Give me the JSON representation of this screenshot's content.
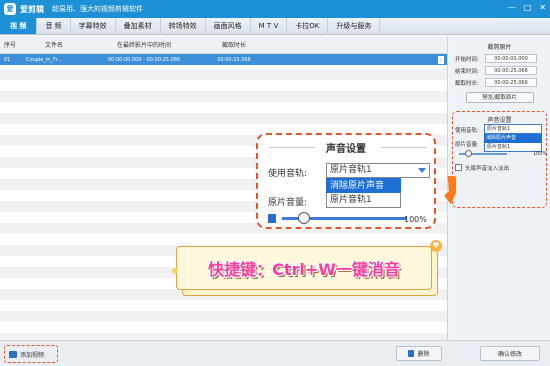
{
  "app": {
    "logo": "爱",
    "name": "爱剪辑",
    "slogan": "超易用、强大的视频剪辑软件",
    "window_buttons": [
      "—",
      "□",
      "✕"
    ]
  },
  "tabs": [
    "视 频",
    "音 频",
    "字幕特效",
    "叠加素材",
    "转场特效",
    "画面风格",
    "M T V",
    "卡拉OK",
    "升级与服务"
  ],
  "file_list": {
    "headers": [
      "序号",
      "文件名",
      "在最终影片中的时间",
      "截取时长"
    ],
    "rows": [
      {
        "index": "01",
        "filename": "Couple_In_Fr...",
        "time": "00:00:00.000 - 00:00:25.066",
        "duration": "00:00:25.066"
      }
    ],
    "row_menu": "⋮"
  },
  "bottom": {
    "add_video": "添加视频",
    "delete": "删除",
    "confirm": "确认修改"
  },
  "right_panel": {
    "cut_title": "裁剪原片",
    "start_label": "开始时间:",
    "start_value": "00:00:00.000",
    "end_label": "结束时间:",
    "end_value": "00:00:25.066",
    "duration_label": "截取时长:",
    "duration_value": "00:00:25.066",
    "preview_button": "预览/截取原片",
    "sound_title": "声音设置",
    "track_label": "使用音轨:",
    "track_selected": "原片音轨1",
    "options": [
      "消除原片声音",
      "原片音轨1"
    ],
    "volume_label": "原片音量:",
    "volume_pct": "100%",
    "fade_label": "头尾声音淡入淡出"
  },
  "zoom_sound": {
    "title": "声音设置",
    "track_label": "使用音轨:",
    "track_selected": "原片音轨1",
    "options": [
      "消除原片声音",
      "原片音轨1"
    ],
    "volume_label": "原片音量:",
    "volume_pct": "100%"
  },
  "banner": {
    "text": "快捷键：Ctrl+W一键消音"
  }
}
